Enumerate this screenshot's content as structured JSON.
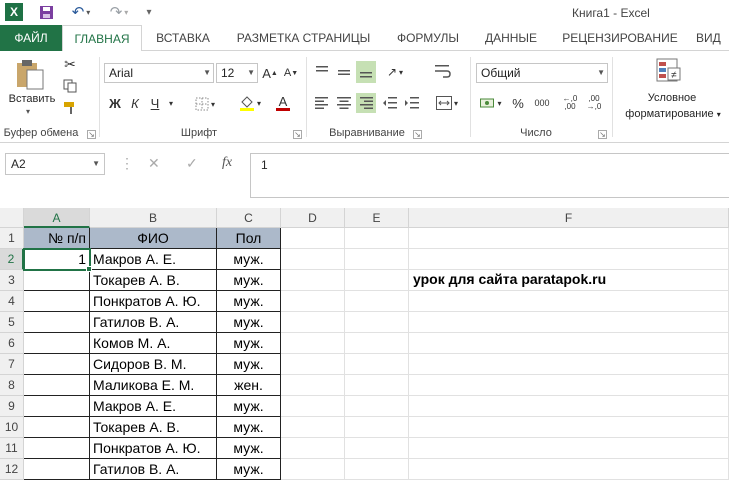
{
  "window": {
    "title": "Книга1 - Excel"
  },
  "qat": {
    "excel_logo": "X",
    "icons": [
      "save-icon",
      "undo-icon",
      "redo-icon",
      "customize-icon"
    ]
  },
  "tabs": [
    {
      "label": "ФАЙЛ"
    },
    {
      "label": "ГЛАВНАЯ"
    },
    {
      "label": "ВСТАВКА"
    },
    {
      "label": "РАЗМЕТКА СТРАНИЦЫ"
    },
    {
      "label": "ФОРМУЛЫ"
    },
    {
      "label": "ДАННЫЕ"
    },
    {
      "label": "РЕЦЕНЗИРОВАНИЕ"
    },
    {
      "label": "ВИД"
    }
  ],
  "ribbon": {
    "clipboard": {
      "paste_label": "Вставить",
      "group_label": "Буфер обмена"
    },
    "font": {
      "font_name": "Arial",
      "font_size": "12",
      "grow": "A",
      "shrink": "A",
      "bold": "Ж",
      "italic": "К",
      "underline": "Ч",
      "font_color_letter": "A",
      "group_label": "Шрифт",
      "font_color": "#c00000"
    },
    "alignment": {
      "group_label": "Выравнивание"
    },
    "number": {
      "format": "Общий",
      "group_label": "Число",
      "percent": "%",
      "comma": "000"
    },
    "styles": {
      "cond_format_line1": "Условное",
      "cond_format_line2": "форматирование"
    }
  },
  "formula_bar": {
    "name_box": "A2",
    "cancel": "✕",
    "enter": "✓",
    "fx": "fx",
    "content": "1"
  },
  "grid": {
    "columns": [
      "A",
      "B",
      "C",
      "D",
      "E",
      "F"
    ],
    "rows": [
      "1",
      "2",
      "3",
      "4",
      "5",
      "6",
      "7",
      "8",
      "9",
      "10",
      "11",
      "12"
    ],
    "header": {
      "num": "№ п/п",
      "name": "ФИО",
      "sex": "Пол"
    },
    "header_fill": "#acb9ca",
    "data": [
      {
        "num": "1",
        "name": "Макров А. Е.",
        "sex": "муж."
      },
      {
        "num": "",
        "name": "Токарев А. В.",
        "sex": "муж."
      },
      {
        "num": "",
        "name": "Понкратов А. Ю.",
        "sex": "муж."
      },
      {
        "num": "",
        "name": "Гатилов В. А.",
        "sex": "муж."
      },
      {
        "num": "",
        "name": "Комов М. А.",
        "sex": "муж."
      },
      {
        "num": "",
        "name": "Сидоров В. М.",
        "sex": "муж."
      },
      {
        "num": "",
        "name": "Маликова Е. М.",
        "sex": "жен."
      },
      {
        "num": "",
        "name": "Макров А. Е.",
        "sex": "муж."
      },
      {
        "num": "",
        "name": "Токарев А. В.",
        "sex": "муж."
      },
      {
        "num": "",
        "name": "Понкратов А. Ю.",
        "sex": "муж."
      },
      {
        "num": "",
        "name": "Гатилов В. А.",
        "sex": "муж."
      }
    ],
    "note": "урок для сайта paratapok.ru"
  },
  "colors": {
    "accent": "#217346"
  }
}
